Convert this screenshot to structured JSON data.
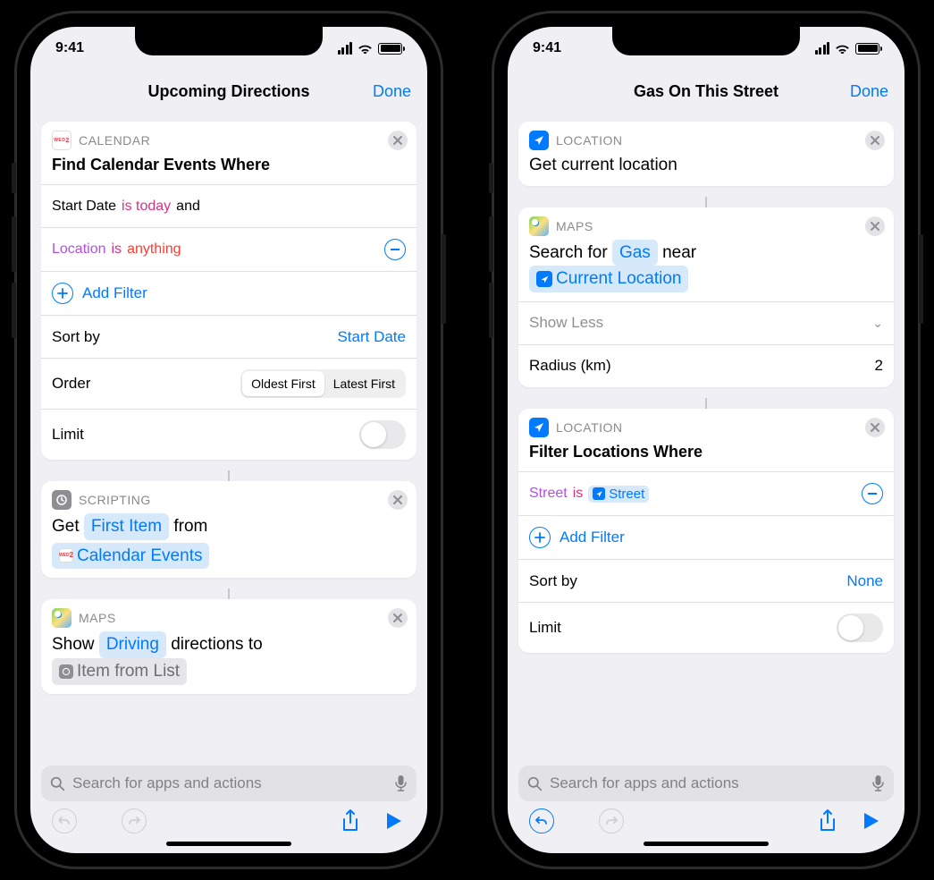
{
  "status": {
    "time": "9:41"
  },
  "left": {
    "title": "Upcoming Directions",
    "done": "Done",
    "card1": {
      "app": "CALENDAR",
      "title": "Find Calendar Events Where",
      "filter1": {
        "a": "Start Date",
        "b": "is today",
        "c": "and"
      },
      "filter2": {
        "a": "Location",
        "b": "is",
        "c": "anything"
      },
      "add_filter": "Add Filter",
      "sort_label": "Sort by",
      "sort_value": "Start Date",
      "order_label": "Order",
      "order_opts": [
        "Oldest First",
        "Latest First"
      ],
      "order_selected": 0,
      "limit_label": "Limit"
    },
    "card2": {
      "app": "SCRIPTING",
      "pre": "Get",
      "tok1": "First Item",
      "mid": "from",
      "tok2": "Calendar Events"
    },
    "card3": {
      "app": "MAPS",
      "pre": "Show",
      "tok1": "Driving",
      "mid": "directions to",
      "tok2": "Item from List"
    },
    "search_placeholder": "Search for apps and actions"
  },
  "right": {
    "title": "Gas On This Street",
    "done": "Done",
    "card1": {
      "app": "LOCATION",
      "title": "Get current location"
    },
    "card2": {
      "app": "MAPS",
      "pre": "Search for",
      "tok1": "Gas",
      "mid": "near",
      "tok2": "Current Location",
      "showless": "Show Less",
      "radius_label": "Radius (km)",
      "radius_value": "2"
    },
    "card3": {
      "app": "LOCATION",
      "title": "Filter Locations Where",
      "filter1": {
        "a": "Street",
        "b": "is",
        "c": "Street"
      },
      "add_filter": "Add Filter",
      "sort_label": "Sort by",
      "sort_value": "None",
      "limit_label": "Limit"
    },
    "search_placeholder": "Search for apps and actions"
  }
}
